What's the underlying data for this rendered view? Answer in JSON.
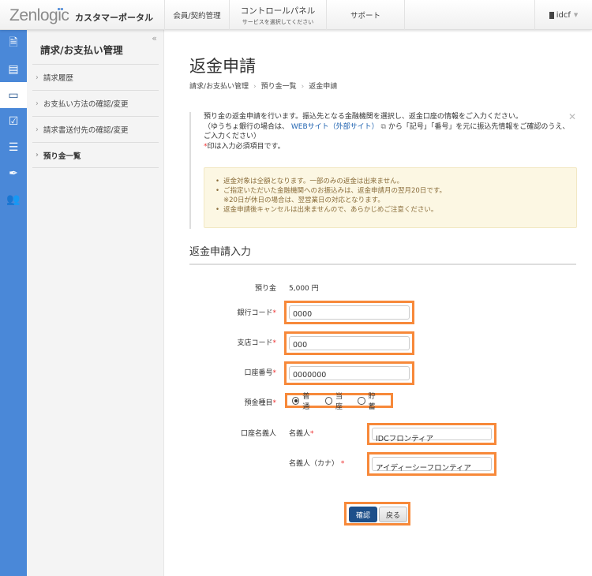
{
  "header": {
    "logo": "Zenlogic",
    "portal": "カスタマーポータル",
    "nav": [
      {
        "label": "会員/契約管理"
      },
      {
        "label": "コントロールパネル",
        "sub": "サービスを選択してください"
      },
      {
        "label": "サポート"
      }
    ],
    "user": "idcf"
  },
  "sidebar": {
    "title": "請求/お支払い管理",
    "items": [
      "請求履歴",
      "お支払い方法の確認/変更",
      "請求書送付先の確認/変更",
      "預り金一覧"
    ]
  },
  "page": {
    "title": "返金申請",
    "breadcrumb": [
      "請求/お支払い管理",
      "預り金一覧",
      "返金申請"
    ]
  },
  "info": {
    "line1": "預り金の返金申請を行います。振込先となる金融機関を選択し、返金口座の情報をご入力ください。",
    "line2a": "（ゆうちょ銀行の場合は、",
    "link": "WEBサイト（外部サイト）",
    "line2b": "から「記号」「番号」を元に振込先情報をご確認のうえ、ご入力ください）",
    "required_mark": "*",
    "required_note": "印は入力必須項目です。",
    "alerts": [
      "返金対象は全額となります。一部のみの返金は出来ません。",
      "ご指定いただいた金融機関へのお振込みは、返金申請月の翌月20日です。",
      "※20日が休日の場合は、翌営業日の対応となります。",
      "返金申請後キャンセルは出来ませんので、あらかじめご注意ください。"
    ]
  },
  "form": {
    "section": "返金申請入力",
    "deposit_label": "預り金",
    "deposit_value": "5,000 円",
    "bank_code_label": "銀行コード",
    "bank_code": "0000",
    "branch_code_label": "支店コード",
    "branch_code": "000",
    "account_no_label": "口座番号",
    "account_no": "0000000",
    "type_label": "預金種目",
    "types": [
      "普通",
      "当座",
      "貯蓄"
    ],
    "selected_type": "普通",
    "holder_label": "口座名義人",
    "name_label": "名義人",
    "name": "IDCフロンティア",
    "kana_label": "名義人（カナ）",
    "kana": "アイディーシーフロンティア",
    "confirm": "確認",
    "back": "戻る"
  },
  "colors": {
    "accent": "#4a88d8",
    "highlight": "#f7893a",
    "primary_button": "#1d4f8a"
  }
}
